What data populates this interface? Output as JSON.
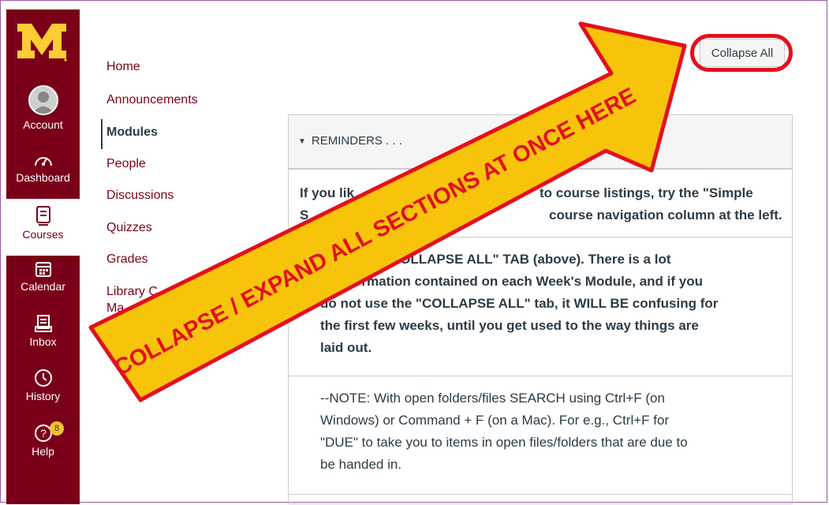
{
  "global_nav": {
    "items": [
      {
        "label": "Account",
        "icon": "account-icon"
      },
      {
        "label": "Dashboard",
        "icon": "dashboard-icon"
      },
      {
        "label": "Courses",
        "icon": "courses-icon",
        "active": true
      },
      {
        "label": "Calendar",
        "icon": "calendar-icon"
      },
      {
        "label": "Inbox",
        "icon": "inbox-icon"
      },
      {
        "label": "History",
        "icon": "history-icon"
      },
      {
        "label": "Help",
        "icon": "help-icon",
        "badge": "8"
      }
    ],
    "brand_color": "#7a0019",
    "logo_color": "#ffcc33"
  },
  "course_nav": {
    "items": [
      {
        "label": "Home"
      },
      {
        "label": "Announcements"
      },
      {
        "label": "Modules",
        "active": true
      },
      {
        "label": "People"
      },
      {
        "label": "Discussions"
      },
      {
        "label": "Quizzes"
      },
      {
        "label": "Grades"
      },
      {
        "label": "Library C"
      },
      {
        "label": "Ma"
      }
    ]
  },
  "toolbar": {
    "collapse_label": "Collapse All"
  },
  "module": {
    "title": "REMINDERS . . .",
    "rows": [
      {
        "lines": [
          "If you lik",
          "to course listings, try the \"Simple",
          "S",
          "course navigation column at the left."
        ]
      },
      {
        "lines": [
          "E THE \"COLLAPSE ALL\" TAB (above). There is a lot",
          "nformation contained on each Week's Module, and if you",
          "do not use the \"COLLAPSE ALL\" tab, it WILL BE confusing for",
          "the first few weeks, until you get used to the way things are",
          "laid out."
        ]
      },
      {
        "lines": [
          "--NOTE: With open folders/files SEARCH using Ctrl+F (on",
          "Windows) or Command + F (on a Mac). For e.g., Ctrl+F for",
          "\"DUE\" to take you to items in open files/folders that are due to",
          "be handed in."
        ]
      }
    ]
  },
  "annotation": {
    "text": "COLLAPSE / EXPAND ALL SECTIONS AT ONCE HERE",
    "fill": "#f7c40b",
    "stroke": "#e3101c"
  }
}
